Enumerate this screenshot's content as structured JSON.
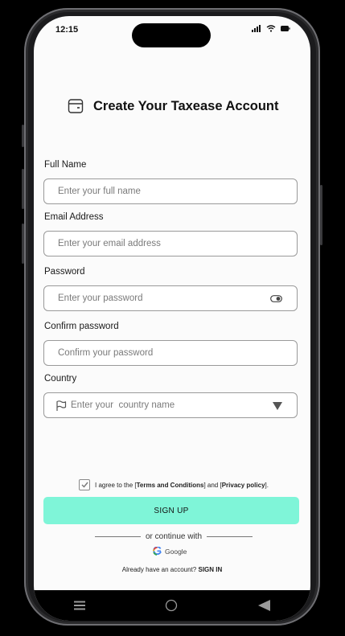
{
  "status_bar": {
    "time": "12:15"
  },
  "header": {
    "title": "Create Your Taxease Account"
  },
  "form": {
    "full_name": {
      "label": "Full Name",
      "placeholder": "Enter your full name"
    },
    "email": {
      "label": "Email Address",
      "placeholder": "Enter your email address"
    },
    "password": {
      "label": "Password",
      "placeholder": "Enter your password"
    },
    "confirm_password": {
      "label": "Confirm password",
      "placeholder": "Confirm your password"
    },
    "country": {
      "label": "Country",
      "placeholder": "Enter your  country name"
    }
  },
  "agreement": {
    "prefix": "I agree to the [",
    "terms": "Terms and Conditions",
    "middle": "] and [",
    "privacy": "Privacy policy",
    "suffix": "].",
    "checked": true
  },
  "actions": {
    "signup_label": "SIGN UP",
    "continue_with": "or continue with",
    "google_label": "Google",
    "have_account": "Already have an account?",
    "signin_label": "SIGN IN"
  },
  "icons": {
    "title": "wallet-icon",
    "password_toggle": "toggle-visibility-icon",
    "country": "flag-icon",
    "dropdown": "triangle-down-icon",
    "nav": [
      "menu-icon",
      "home-circle-icon",
      "back-triangle-icon"
    ]
  },
  "colors": {
    "accent": "#7ff5d8",
    "background": "#fbfbfb"
  }
}
